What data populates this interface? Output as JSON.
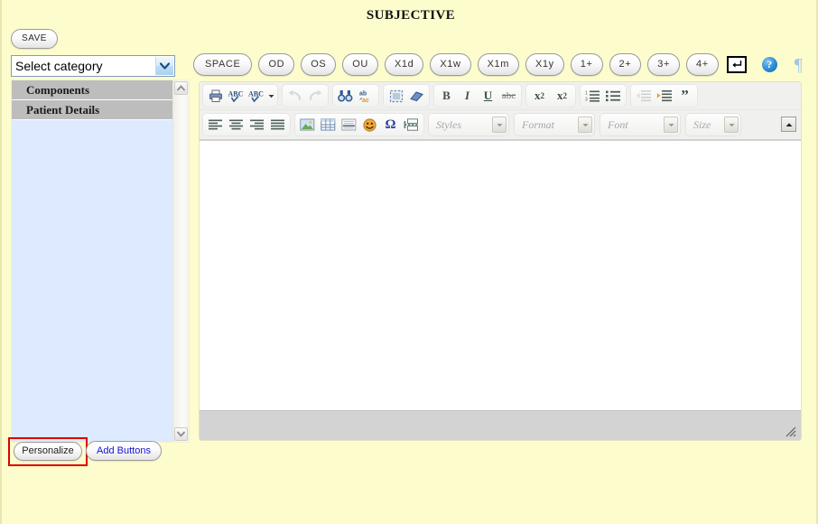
{
  "page": {
    "title": "SUBJECTIVE",
    "background_color": "#fdfccc"
  },
  "left_panel": {
    "save_label": "SAVE",
    "category_select": {
      "selected": "Select category",
      "icon": "chevron-down-icon"
    },
    "groups": [
      {
        "label": "Components"
      },
      {
        "label": "Patient Details"
      }
    ],
    "scrollbar": {
      "up_icon": "chevron-up-icon",
      "down_icon": "chevron-down-icon"
    },
    "personalize_label": "Personalize",
    "add_buttons_label": "Add Buttons",
    "highlight_color": "#dd0000"
  },
  "quick_buttons": [
    {
      "label": "SPACE"
    },
    {
      "label": "OD"
    },
    {
      "label": "OS"
    },
    {
      "label": "OU"
    },
    {
      "label": "X1d"
    },
    {
      "label": "X1w"
    },
    {
      "label": "X1m"
    },
    {
      "label": "X1y"
    },
    {
      "label": "1+"
    },
    {
      "label": "2+"
    },
    {
      "label": "3+"
    },
    {
      "label": "4+"
    }
  ],
  "quick_icons": {
    "enter_key": "enter-return-icon",
    "help": "?",
    "pilcrow": "¶"
  },
  "editor": {
    "toolbar_row_1": [
      {
        "group": [
          "print-icon",
          "spellcheck-icon",
          "spellcheck-options-icon"
        ]
      },
      {
        "group": [
          "undo-icon",
          "redo-icon"
        ]
      },
      {
        "group": [
          "find-icon",
          "replace-icon"
        ]
      },
      {
        "group": [
          "select-all-icon",
          "remove-format-icon"
        ]
      },
      {
        "group": [
          "bold-icon",
          "italic-icon",
          "underline-icon",
          "strikethrough-icon"
        ]
      },
      {
        "group": [
          "subscript-icon",
          "superscript-icon"
        ]
      },
      {
        "group": [
          "numbered-list-icon",
          "bulleted-list-icon"
        ]
      },
      {
        "group": [
          "decrease-indent-icon",
          "increase-indent-icon",
          "blockquote-icon"
        ]
      }
    ],
    "toolbar_row_2": [
      {
        "group": [
          "align-left-icon",
          "align-center-icon",
          "align-right-icon",
          "align-justify-icon"
        ]
      },
      {
        "group": [
          "image-icon",
          "table-icon",
          "horizontal-rule-icon",
          "smiley-icon",
          "special-character-icon",
          "page-break-icon"
        ]
      }
    ],
    "labels": {
      "bold": "B",
      "italic": "I",
      "underline": "U",
      "strikethrough": "abc",
      "subscript": "x",
      "subscript_index": "2",
      "superscript": "x",
      "superscript_index": "2",
      "blockquote": "”",
      "spellcheck": "ABC",
      "omega": "Ω"
    },
    "combos": [
      {
        "name": "styles",
        "placeholder": "Styles"
      },
      {
        "name": "format",
        "placeholder": "Format"
      },
      {
        "name": "font",
        "placeholder": "Font"
      },
      {
        "name": "size",
        "placeholder": "Size"
      }
    ],
    "collapse_icon": "triangle-up-icon",
    "content": "",
    "resize_grip_icon": "resize-grip-icon"
  }
}
